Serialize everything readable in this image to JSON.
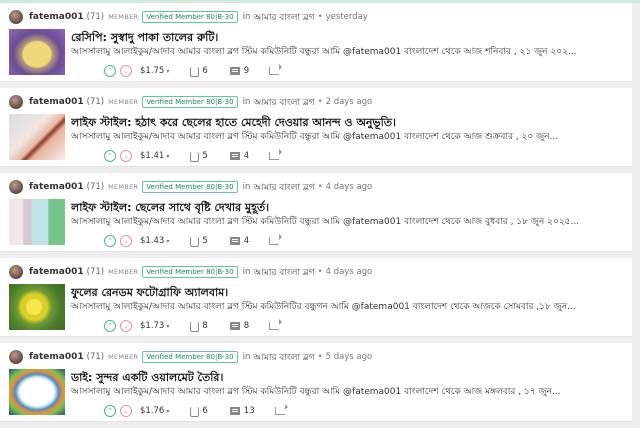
{
  "colors": {
    "accent_green": "#50b887",
    "downvote_red": "#e79696",
    "badge_green": "#1f8a5a"
  },
  "icons": {
    "upvote": "chevron-up-circle-icon",
    "downvote": "chevron-down-circle-icon",
    "payout_dropdown": "caret-down-icon",
    "voters": "voters-icon",
    "comments": "comment-icon",
    "reblog": "reblog-icon"
  },
  "posts": [
    {
      "author": "fatema001",
      "reputation": "(71)",
      "role": "MEMBER",
      "badge": "Verified Member 80|B-30",
      "in_label": "in",
      "community": "আমার বাংলা ব্লগ",
      "dot": "•",
      "time": "yesterday",
      "title": "রেসিপি: সুস্বাদু পাকা তালের রুটি।",
      "body": "আসসালামু আলাইকুম/আদাব আমার বাংলা ব্লগ স্টিম কমিউনিটি বন্ধুরা আমি @fatema001 বাংলাদেশ থেকে আজ শনিবার , ২১ জুন ২০২...",
      "upvote": "⌃",
      "downvote": "⌄",
      "payout": "$1.75",
      "caret": "▾",
      "votes": "6",
      "comments": "9"
    },
    {
      "author": "fatema001",
      "reputation": "(71)",
      "role": "MEMBER",
      "badge": "Verified Member 80|B-30",
      "in_label": "in",
      "community": "আমার বাংলা ব্লগ",
      "dot": "•",
      "time": "2 days ago",
      "title": "লাইফ স্টাইল: হঠাৎ করে ছেলের হাতে মেহেদী দেওয়ার আনন্দ ও অনুভূতি।",
      "body": "আসসালামু আলাইকুম/আদাব আমার বাংলা ব্লগ স্টিম কমিউনিটি বন্ধুরা আমি @fatema001 বাংলাদেশ থেকে আজ শুক্রবার , ২০ জুন...",
      "upvote": "⌃",
      "downvote": "⌄",
      "payout": "$1.41",
      "caret": "▾",
      "votes": "5",
      "comments": "4"
    },
    {
      "author": "fatema001",
      "reputation": "(71)",
      "role": "MEMBER",
      "badge": "Verified Member 80|B-30",
      "in_label": "in",
      "community": "আমার বাংলা ব্লগ",
      "dot": "•",
      "time": "4 days ago",
      "title": "লাইফ স্টাইল: ছেলের সাথে বৃষ্টি দেখার মুহূর্ত।",
      "body": "আসসালামু আলাইকুম/আদাব আমার বাংলা ব্লগ স্টিম কমিউনিটি বন্ধুরা আমি @fatema001 বাংলাদেশ থেকে আজ বুধবার , ১৮ জুন ২০২৫...",
      "upvote": "⌃",
      "downvote": "⌄",
      "payout": "$1.43",
      "caret": "▾",
      "votes": "5",
      "comments": "4"
    },
    {
      "author": "fatema001",
      "reputation": "(71)",
      "role": "MEMBER",
      "badge": "Verified Member 80|B-30",
      "in_label": "in",
      "community": "আমার বাংলা ব্লগ",
      "dot": "•",
      "time": "4 days ago",
      "title": "ফুলের রেনডম ফটোগ্রাফি অ্যালবাম।",
      "body": "আসসালামু আলাইকুম/আদাব আমার বাংলা ব্লগ স্টিম কমিউনিটির বন্ধুগন আমি @fatema001 বাংলাদেশ থেকে আজকে সোমবার ,১৮ জুন...",
      "upvote": "⌃",
      "downvote": "⌄",
      "payout": "$1.73",
      "caret": "▾",
      "votes": "8",
      "comments": "8"
    },
    {
      "author": "fatema001",
      "reputation": "(71)",
      "role": "MEMBER",
      "badge": "Verified Member 80|B-30",
      "in_label": "in",
      "community": "আমার বাংলা ব্লগ",
      "dot": "•",
      "time": "5 days ago",
      "title": "ডাই: সুন্দর একটি ওয়ালমেট তৈরি।",
      "body": "আসসালামু আলাইকুম/আদাব আমার বাংলা ব্লগ স্টিম কমিউনিটি বন্ধুরা আমি @fatema001 বাংলাদেশ থেকে আজ মঙ্গলবার , ১৭ জুন...",
      "upvote": "⌃",
      "downvote": "⌄",
      "payout": "$1.76",
      "caret": "▾",
      "votes": "6",
      "comments": "13"
    }
  ]
}
